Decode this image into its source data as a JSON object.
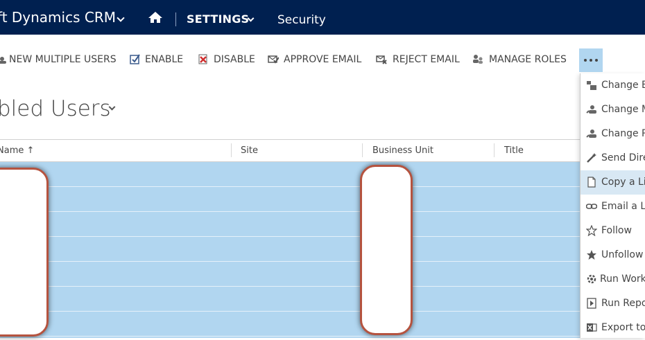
{
  "topnav": {
    "app_title": "ft Dynamics CRM",
    "settings": "SETTINGS",
    "security": "Security"
  },
  "toolbar": {
    "new_multiple_users": "NEW MULTIPLE USERS",
    "enable": "ENABLE",
    "disable": "DISABLE",
    "approve_email": "APPROVE EMAIL",
    "reject_email": "REJECT EMAIL",
    "manage_roles": "MANAGE ROLES"
  },
  "view": {
    "title": "bled Users"
  },
  "grid": {
    "columns": [
      "Name ↑",
      "Site",
      "Business Unit",
      "Title"
    ]
  },
  "menu": {
    "items": [
      "Change B",
      "Change M",
      "Change P",
      "Send Dire",
      "Copy a Li",
      "Email a Li",
      "Follow",
      "Unfollow",
      "Run Work",
      "Run Repo",
      "Export to"
    ]
  },
  "colors": {
    "nav_bg": "#002050",
    "row_selected": "#b1d6f0",
    "redaction_border": "#b5533f"
  }
}
